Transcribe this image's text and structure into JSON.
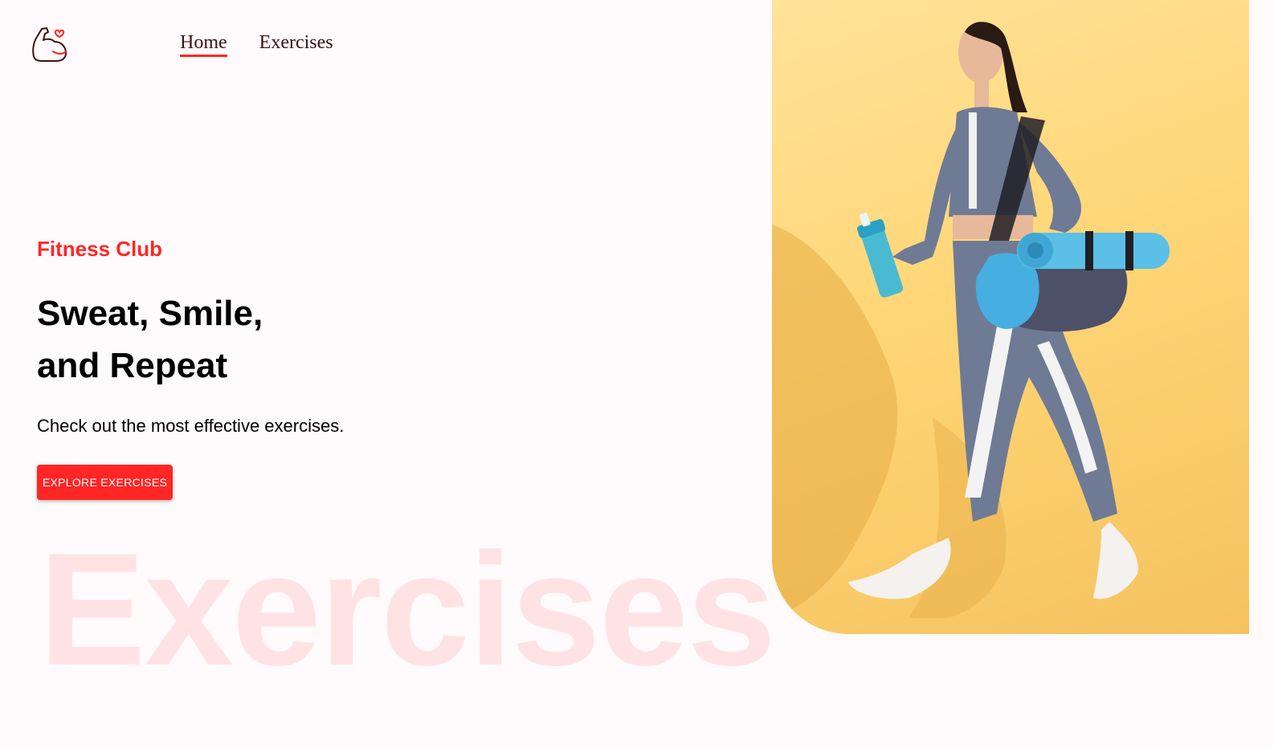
{
  "brand": {
    "logo_icon": "flexed-arm-heart-icon",
    "accent": "#ff2625"
  },
  "nav": {
    "items": [
      {
        "label": "Home",
        "active": true
      },
      {
        "label": "Exercises",
        "active": false
      }
    ]
  },
  "hero": {
    "tag": "Fitness Club",
    "title_line1": "Sweat, Smile,",
    "title_line2": "and Repeat",
    "subtitle": "Check out the most effective exercises.",
    "cta_label": "EXPLORE EXERCISES",
    "watermark": "Exercises"
  },
  "banner": {
    "background": "#ffd676",
    "image_subject": "woman-walking-with-gym-bag-and-bottle"
  }
}
